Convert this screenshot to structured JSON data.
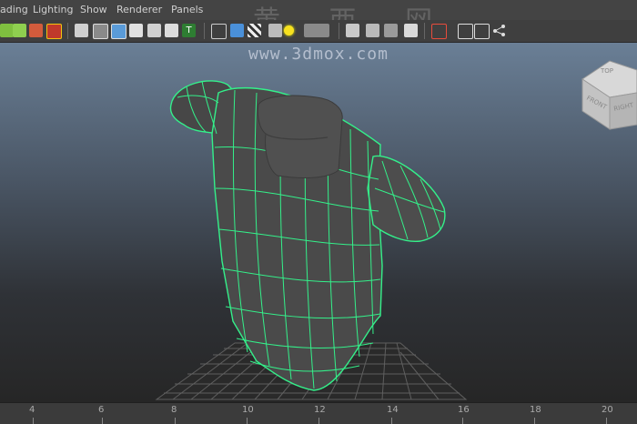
{
  "menubar": {
    "items": [
      "ading",
      "Lighting",
      "Show",
      "Renderer",
      "Panels"
    ]
  },
  "watermark": {
    "chinese": "黄 西 网",
    "url": "www.3dmox.com"
  },
  "viewcube": {
    "top_label": "TOP",
    "front_label": "FRONT",
    "right_label": "RIGHT"
  },
  "timeline": {
    "ticks": [
      "4",
      "6",
      "8",
      "10",
      "12",
      "14",
      "16",
      "18",
      "20"
    ]
  },
  "colors": {
    "wireframe": "#34f08a",
    "mesh": "#4a4a4a",
    "collar": "#505050",
    "grid": "#6a6a6a"
  },
  "toolbar": {
    "icons": [
      "snap-curve-icon",
      "snap-point-icon",
      "snap-view-icon",
      "make-live-icon",
      "wireframe-shading-icon",
      "smooth-shading-icon",
      "textured-icon",
      "lights-icon",
      "shadows-icon",
      "xray-icon",
      "text-icon",
      "camera-icon",
      "cube-icon",
      "checker-icon",
      "light-bulb-icon",
      "isolate-icon",
      "select-icon",
      "object-icon",
      "component-icon",
      "share-icon"
    ]
  }
}
